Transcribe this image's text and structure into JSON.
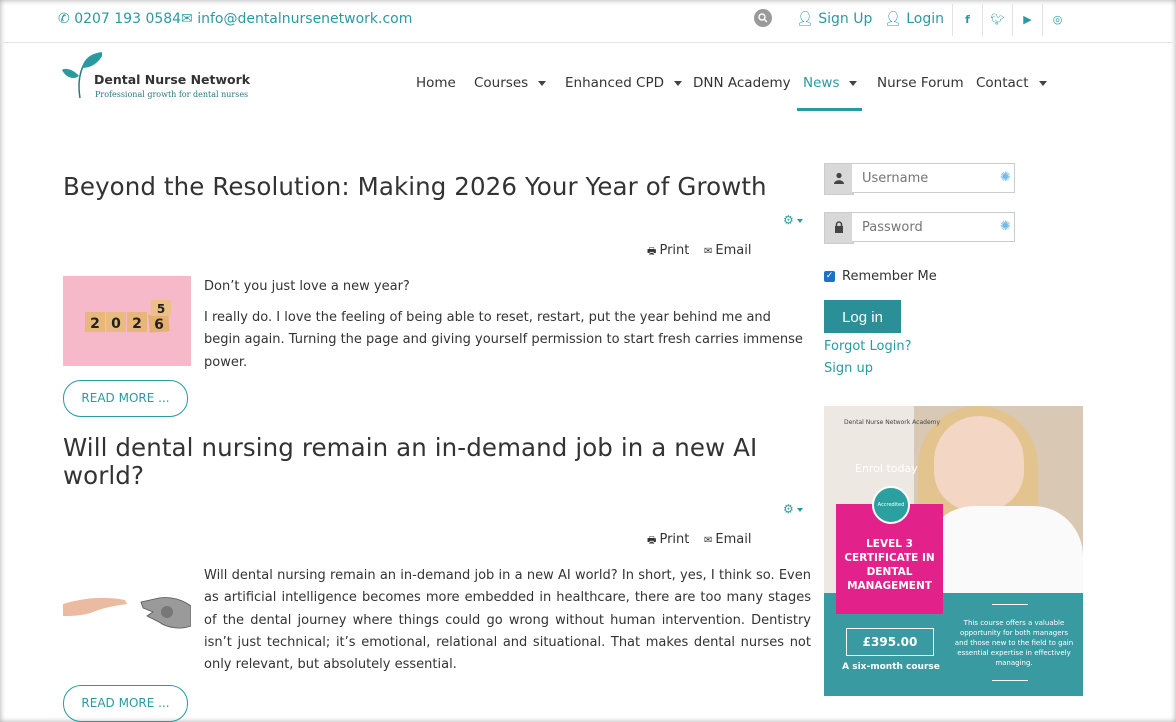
{
  "topbar": {
    "phone": "0207 193 0584",
    "email": "info@dentalnursenetwork.com",
    "signup": "Sign Up",
    "login": "Login",
    "social": [
      "f",
      "t",
      "yt",
      "ig"
    ]
  },
  "logo": {
    "name": "Dental Nurse Network",
    "tagline": "Professional growth for dental nurses"
  },
  "nav": {
    "items": [
      "Home",
      "Courses",
      "Enhanced CPD",
      "DNN Academy",
      "News",
      "Nurse Forum",
      "Contact"
    ],
    "active": "News"
  },
  "articles": [
    {
      "title": "Beyond the Resolution: Making 2026 Your Year of Growth",
      "print": "Print",
      "email": "Email",
      "paragraphs": [
        "Don’t you just love a new year?",
        "I really do. I love the feeling of being able to reset, restart, put the year behind me and begin again. Turning the page and giving yourself permission to start fresh carries immense power."
      ],
      "image_digits": [
        "2",
        "0",
        "2",
        "6",
        "5"
      ],
      "read_more": "READ MORE ..."
    },
    {
      "title": "Will dental nursing remain an in-demand job in a new AI world?",
      "print": "Print",
      "email": "Email",
      "paragraphs": [
        "Will dental nursing remain an in-demand job in a new AI world? In short, yes, I think so. Even as artificial intelligence becomes more embedded in healthcare, there are too many stages of the dental journey where things could go wrong without human intervention. Dentistry isn’t just technical; it’s emotional, relational and situational. That makes dental nurses not only relevant, but absolutely essential."
      ],
      "read_more": "READ MORE ..."
    }
  ],
  "login_form": {
    "username_placeholder": "Username",
    "password_placeholder": "Password",
    "remember": "Remember Me",
    "remember_checked": true,
    "button": "Log in",
    "forgot": "Forgot Login?",
    "signup": "Sign up"
  },
  "ad": {
    "brand": "Dental Nurse Network Academy",
    "enrol": "Enrol today",
    "badge": "Accredited",
    "course_lines": [
      "LEVEL 3",
      "CERTIFICATE IN",
      "DENTAL",
      "MANAGEMENT"
    ],
    "price": "£395.00",
    "duration": "A six-month course",
    "description": "This course offers a valuable opportunity for both managers and those new to the field to gain essential expertise in effectively managing."
  },
  "colors": {
    "accent": "#2a9aa0",
    "login_button": "#2a8f96",
    "ad_pink": "#e3218b",
    "ad_teal": "#3a9aa2"
  }
}
